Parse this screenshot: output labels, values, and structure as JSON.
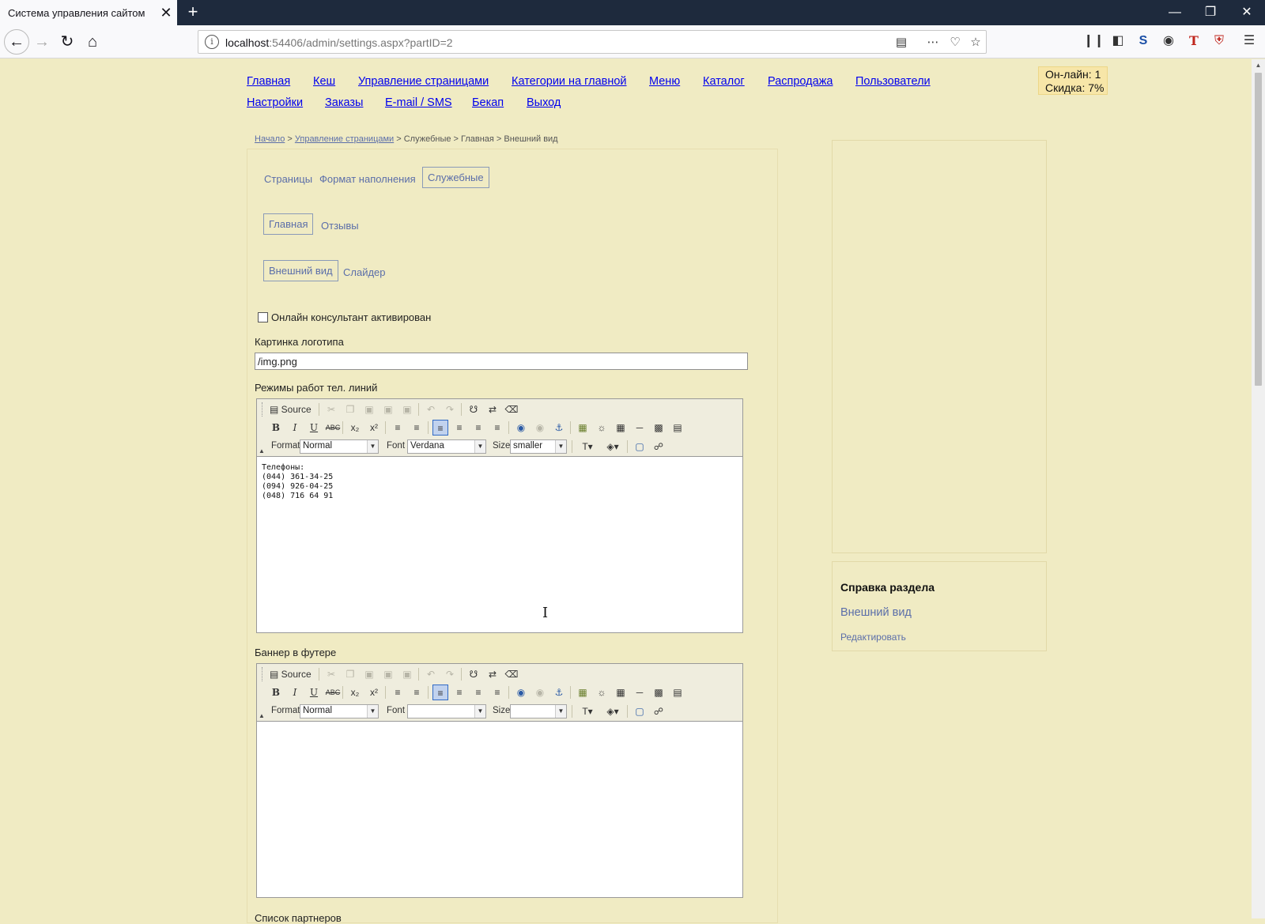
{
  "browser": {
    "tab_title": "Система управления сайтом",
    "tab_close": "✕",
    "new_tab": "+",
    "url_host": "localhost",
    "url_rest": ":54406/admin/settings.aspx?partID=2",
    "window_controls": [
      "—",
      "❐",
      "✕"
    ]
  },
  "nav": {
    "row1": [
      "Главная",
      "Кеш",
      "Управление страницами",
      "Категории на главной",
      "Меню",
      "Каталог",
      "Распродажа",
      "Пользователи"
    ],
    "row2": [
      "Настройки",
      "Заказы",
      "E-mail / SMS",
      "Бекап",
      "Выход"
    ]
  },
  "status": {
    "online": "Он-лайн: 1",
    "discount": "Скидка: 7%"
  },
  "breadcrumb": {
    "start": "Начало",
    "sep1": " > ",
    "pages": "Управление страницами",
    "rest": " > Служебные > Главная > Внешний вид"
  },
  "tabs": {
    "level1": [
      "Страницы",
      "Формат наполнения",
      "Служебные"
    ],
    "level2": [
      "Главная",
      "Отзывы"
    ],
    "level3": [
      "Внешний вид",
      "Слайдер"
    ]
  },
  "form": {
    "consultant_label": "Онлайн консультант активирован",
    "logo_label": "Картинка логотипа",
    "logo_value": "/img.png",
    "phones_label": "Режимы работ тел. линий",
    "banner_label": "Баннер в футере",
    "partners_label": "Список партнеров"
  },
  "editor": {
    "source_label": "Source",
    "format_label": "Format",
    "font_label": "Font",
    "size_label": "Size",
    "format_value": "Normal",
    "phones_font_value": "Verdana",
    "phones_size_value": "smaller",
    "banner_font_value": "",
    "banner_size_value": ""
  },
  "phones_content": [
    "Телефоны:",
    "(044) 361-34-25",
    "(094) 926-04-25",
    "(048) 716 64 91"
  ],
  "help": {
    "title": "Справка раздела",
    "link": "Внешний вид",
    "edit": "Редактировать"
  }
}
